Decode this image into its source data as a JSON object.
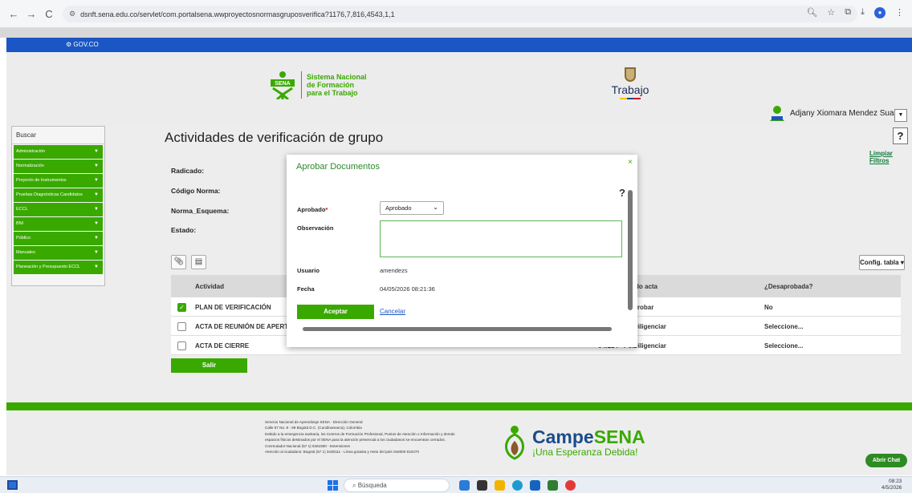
{
  "browser": {
    "url": "dsnft.sena.edu.co/servlet/com.portalsena.wwproyectosnormasgruposverifica?1176,7,816,4543,1,1",
    "nav": [
      "←",
      "→",
      "C"
    ]
  },
  "gov": {
    "label": "GOV.CO"
  },
  "header": {
    "sena_logo_text": [
      "Sistema Nacional",
      "de Formación",
      "para el Trabajo"
    ],
    "sena_wordmark": "SENA",
    "trabajo_label": "Trabajo",
    "user_name": "Adjany Xiomara Mendez Suarez"
  },
  "sidebar": {
    "search_label": "Buscar",
    "items": [
      "Administración",
      "Normalización",
      "Proyecto de Instrumentos",
      "Pruebas Diagnósticas Candidatos",
      "ECCL",
      "BNI",
      "Público",
      "Manuales",
      "Planeación y Presupuesto ECCL"
    ]
  },
  "main": {
    "title": "Actividades de verificación de grupo",
    "help": "?",
    "limpiar_filtros": "Limpiar Filtros",
    "fields": [
      "Radicado:",
      "Código Norma:",
      "Norma_Esquema:",
      "Estado:"
    ],
    "config_tabla": "Config. tabla ▾",
    "table": {
      "headers": {
        "actividad": "Actividad",
        "estado_acta": "do acta",
        "desaprobada": "¿Desaprobada?"
      },
      "rows": [
        {
          "actividad": "PLAN DE VERIFICACIÓN",
          "estado": "probar",
          "desaprobada": "No",
          "checked": true
        },
        {
          "actividad": "ACTA DE REUNIÓN DE APERTURA",
          "estado": "Diligenciar",
          "desaprobada": "Seleccione...",
          "checked": false
        },
        {
          "actividad": "ACTA DE CIERRE",
          "estado": "Diligenciar",
          "desaprobada": "Seleccione...",
          "checked": false
        }
      ],
      "row3_prefix": "04:214 · Por"
    },
    "salir": "Salir"
  },
  "modal": {
    "title": "Aprobar Documentos",
    "close": "×",
    "help": "?",
    "aprobado_label": "Aprobado",
    "required_mark": "*",
    "aprobado_value": "Aprobado",
    "observacion_label": "Observación",
    "observacion_value": "",
    "usuario_label": "Usuario",
    "usuario_value": "amendezs",
    "fecha_label": "Fecha",
    "fecha_value": "04/05/2026 08:21:36",
    "aceptar": "Aceptar",
    "cancelar": "Cancelar"
  },
  "footer": {
    "lines": [
      "Servicio Nacional de Aprendizaje SENA - Dirección General",
      "Calle 57 No. 8 - 69 Bogotá D.C. (Cundinamarca), Colombia",
      "Debido a la emergencia sanitaria, los Centros de Formación Profesional, Puntos de Atención o Información y demás",
      "espacios físicos destinados por el SENA para la atención presencial a los ciudadanos se encuentran cerrados.",
      "Conmutador Nacional (57 1) 5461500 - Extensiones",
      "Atención al ciudadano: Bogotá (57 1) 3430111 - Línea gratuita y resto del país 018000 910270"
    ],
    "campe_title_a": "Campe",
    "campe_title_b": "SENA",
    "campe_sub": "¡Una Esperanza Debida!",
    "abrir_chat": "Abrir Chat"
  },
  "taskbar": {
    "search": "Búsqueda",
    "time": "08:23",
    "date": "4/5/2026"
  },
  "colors": {
    "sena_green": "#39a900",
    "gov_blue": "#1a56c4"
  }
}
